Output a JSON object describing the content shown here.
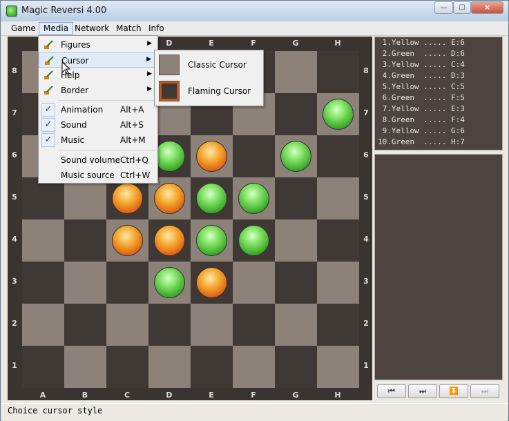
{
  "window": {
    "title": "Magic Reversi 4.00",
    "min": "—",
    "max": "☐",
    "close": "✕"
  },
  "menubar": [
    "Game",
    "Media",
    "Network",
    "Match",
    "Info"
  ],
  "board": {
    "columns": [
      "A",
      "B",
      "C",
      "D",
      "E",
      "F",
      "G",
      "H"
    ],
    "rows": [
      "8",
      "7",
      "6",
      "5",
      "4",
      "3",
      "2",
      "1"
    ],
    "discs": [
      {
        "square": "H7",
        "color": "green"
      },
      {
        "square": "D6",
        "color": "green"
      },
      {
        "square": "E6",
        "color": "yellow"
      },
      {
        "square": "G6",
        "color": "green"
      },
      {
        "square": "C5",
        "color": "yellow"
      },
      {
        "square": "D5",
        "color": "yellow"
      },
      {
        "square": "E5",
        "color": "green"
      },
      {
        "square": "F5",
        "color": "green"
      },
      {
        "square": "C4",
        "color": "yellow"
      },
      {
        "square": "D4",
        "color": "yellow"
      },
      {
        "square": "E4",
        "color": "green"
      },
      {
        "square": "F4",
        "color": "green"
      },
      {
        "square": "D3",
        "color": "green"
      },
      {
        "square": "E3",
        "color": "yellow"
      }
    ]
  },
  "moves": [
    " 1.Yellow ..... E:6",
    " 2.Green  ..... D:6",
    " 3.Yellow ..... C:4",
    " 4.Green  ..... D:3",
    " 5.Yellow ..... C:5",
    " 6.Green  ..... F:5",
    " 7.Yellow ..... E:3",
    " 8.Green  ..... F:4",
    " 9.Yellow ..... G:6",
    "10.Green  ..... H:7"
  ],
  "nav_buttons": [
    "⏮",
    "⏭",
    "⏬",
    "⏭"
  ],
  "media_menu": {
    "items": [
      {
        "label": "Figures",
        "shortcut": "",
        "submenu": true,
        "icon": "brush-icon"
      },
      {
        "label": "Cursor",
        "shortcut": "",
        "submenu": true,
        "icon": "brush-icon",
        "highlighted": true
      },
      {
        "label": "Help",
        "shortcut": "",
        "submenu": true,
        "icon": "brush-icon"
      },
      {
        "label": "Border",
        "shortcut": "",
        "submenu": true,
        "icon": "brush-icon"
      },
      {
        "label": "Animation",
        "shortcut": "Alt+A",
        "checked": true
      },
      {
        "label": "Sound",
        "shortcut": "Alt+S",
        "checked": true
      },
      {
        "label": "Music",
        "shortcut": "Alt+M",
        "checked": true
      },
      {
        "label": "Sound volume",
        "shortcut": "Ctrl+Q"
      },
      {
        "label": "Music source",
        "shortcut": "Ctrl+W"
      }
    ]
  },
  "cursor_submenu": [
    "Classic Cursor",
    "Flaming Cursor"
  ],
  "status": "Choice cursor style"
}
